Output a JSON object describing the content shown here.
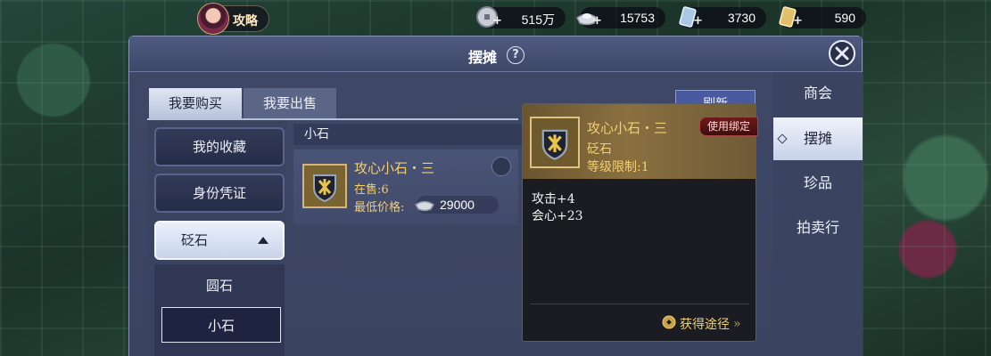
{
  "topbar": {
    "strategy_label": "攻略",
    "currencies": [
      {
        "icon": "silver-coin-icon",
        "value": "515万"
      },
      {
        "icon": "silver-ingot-icon",
        "value": "15753"
      },
      {
        "icon": "ticket-icon",
        "value": "3730"
      },
      {
        "icon": "gold-ticket-icon",
        "value": "590"
      }
    ]
  },
  "panel": {
    "title": "摆摊",
    "help_symbol": "?",
    "tabs": [
      {
        "label": "我要购买",
        "active": true
      },
      {
        "label": "我要出售",
        "active": false
      }
    ],
    "refresh_label": "刷新"
  },
  "categories": {
    "items": [
      "我的收藏",
      "身份凭证"
    ],
    "open": "砭石",
    "sub_items": [
      "圆石",
      "小石"
    ],
    "selected_sub": "小石"
  },
  "listing": {
    "header": "小石",
    "item": {
      "name": "攻心小石・三",
      "on_sale": "在售:6",
      "lowest_price_label": "最低价格:",
      "price": "29000"
    },
    "faded_price": "29000"
  },
  "right_nav": {
    "items": [
      {
        "label": "商会",
        "active": false
      },
      {
        "label": "摆摊",
        "active": true
      },
      {
        "label": "珍品",
        "active": false
      },
      {
        "label": "拍卖行",
        "active": false
      }
    ]
  },
  "tooltip": {
    "name": "攻心小石・三",
    "bind_label": "使用绑定",
    "type": "砭石",
    "level_req": "等级限制:1",
    "stats": [
      "攻击+4",
      "会心+23"
    ],
    "obtain_label": "获得途径"
  },
  "colors": {
    "gold_text": "#f2cf70",
    "panel_bg": "#3f4866",
    "tooltip_bg": "#1b1c22"
  }
}
